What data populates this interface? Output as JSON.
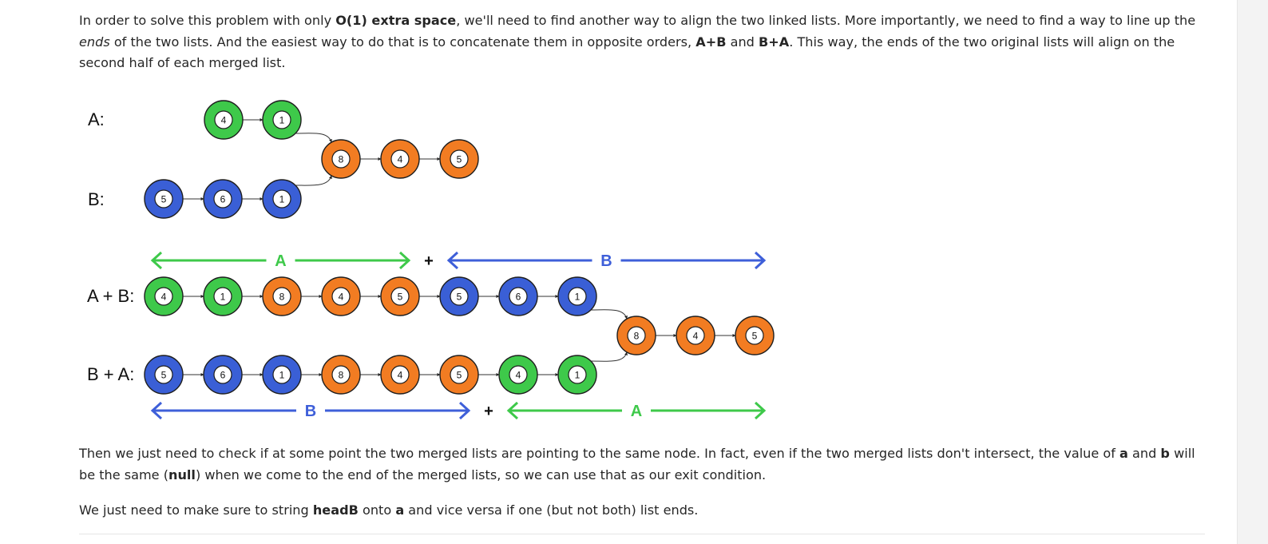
{
  "paragraph1": {
    "t1": "In order to solve this problem with only ",
    "b1": "O(1) extra space",
    "t2": ", we'll need to find another way to align the two linked lists. More importantly, we need to find a way to line up the ",
    "i1": "ends",
    "t3": " of the two lists. And the easiest way to do that is to concatenate them in opposite orders, ",
    "b2": "A+B",
    "t4": " and ",
    "b3": "B+A",
    "t5": ". This way, the ends of the two original lists will align on the second half of each merged list."
  },
  "paragraph2": {
    "t1": "Then we just need to check if at some point the two merged lists are pointing to the same node. In fact, even if the two merged lists don't intersect, the value of ",
    "b1": "a",
    "t2": " and ",
    "b2": "b",
    "t3": " will be the same (",
    "b3": "null",
    "t4": ") when we come to the end of the merged lists, so we can use that as our exit condition."
  },
  "paragraph3": {
    "t1": "We just need to make sure to string ",
    "b1": "headB",
    "t2": " onto ",
    "b2": "a",
    "t3": " and vice versa if one (but not both) list ends."
  },
  "diagram": {
    "colors": {
      "green": "#3ec94a",
      "orange": "#f27c22",
      "blue": "#3a5fd6",
      "arrow_green": "#3ec94a",
      "arrow_blue": "#3e5fd9"
    },
    "row_labels": {
      "a": "A:",
      "b": "B:",
      "ab": "A + B:",
      "ba": "B + A:"
    },
    "list_a": [
      {
        "value": "4",
        "color": "green"
      },
      {
        "value": "1",
        "color": "green"
      }
    ],
    "list_b": [
      {
        "value": "5",
        "color": "blue"
      },
      {
        "value": "6",
        "color": "blue"
      },
      {
        "value": "1",
        "color": "blue"
      }
    ],
    "shared": [
      {
        "value": "8",
        "color": "orange"
      },
      {
        "value": "4",
        "color": "orange"
      },
      {
        "value": "5",
        "color": "orange"
      }
    ],
    "merged_ab": [
      {
        "value": "4",
        "color": "green"
      },
      {
        "value": "1",
        "color": "green"
      },
      {
        "value": "8",
        "color": "orange"
      },
      {
        "value": "4",
        "color": "orange"
      },
      {
        "value": "5",
        "color": "orange"
      },
      {
        "value": "5",
        "color": "blue"
      },
      {
        "value": "6",
        "color": "blue"
      },
      {
        "value": "1",
        "color": "blue"
      }
    ],
    "merged_ba": [
      {
        "value": "5",
        "color": "blue"
      },
      {
        "value": "6",
        "color": "blue"
      },
      {
        "value": "1",
        "color": "blue"
      },
      {
        "value": "8",
        "color": "orange"
      },
      {
        "value": "4",
        "color": "orange"
      },
      {
        "value": "5",
        "color": "orange"
      },
      {
        "value": "4",
        "color": "green"
      },
      {
        "value": "1",
        "color": "green"
      }
    ],
    "merged_shared": [
      {
        "value": "8",
        "color": "orange"
      },
      {
        "value": "4",
        "color": "orange"
      },
      {
        "value": "5",
        "color": "orange"
      }
    ],
    "span_top": {
      "first": "A",
      "plus": "+",
      "second": "B"
    },
    "span_bottom": {
      "first": "B",
      "plus": "+",
      "second": "A"
    }
  }
}
